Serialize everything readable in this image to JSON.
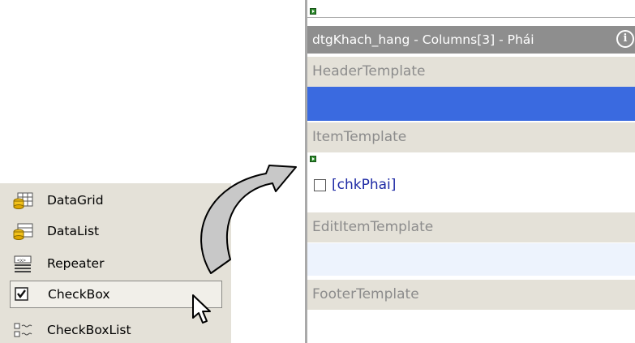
{
  "toolbox": {
    "items": [
      {
        "label": "DataGrid",
        "icon": "datagrid-icon"
      },
      {
        "label": "DataList",
        "icon": "datalist-icon"
      },
      {
        "label": "Repeater",
        "icon": "repeater-icon"
      },
      {
        "label": "CheckBox",
        "icon": "checkbox-icon",
        "selected": true
      },
      {
        "label": "CheckBoxList",
        "icon": "checkboxlist-icon"
      }
    ]
  },
  "editor": {
    "title": "dtgKhach_hang - Columns[3] - Phái",
    "info_glyph": "i",
    "sections": {
      "header": "HeaderTemplate",
      "item": "ItemTemplate",
      "edit_item": "EditItemTemplate",
      "footer": "FooterTemplate"
    },
    "checkbox_label": "[chkPhai]"
  },
  "colors": {
    "title_bar": "#8e8e8e",
    "header_fill": "#3a6ae0",
    "edit_fill": "#edf3fd",
    "panel": "#e4e1d8",
    "link_text": "#1e2aa5"
  }
}
